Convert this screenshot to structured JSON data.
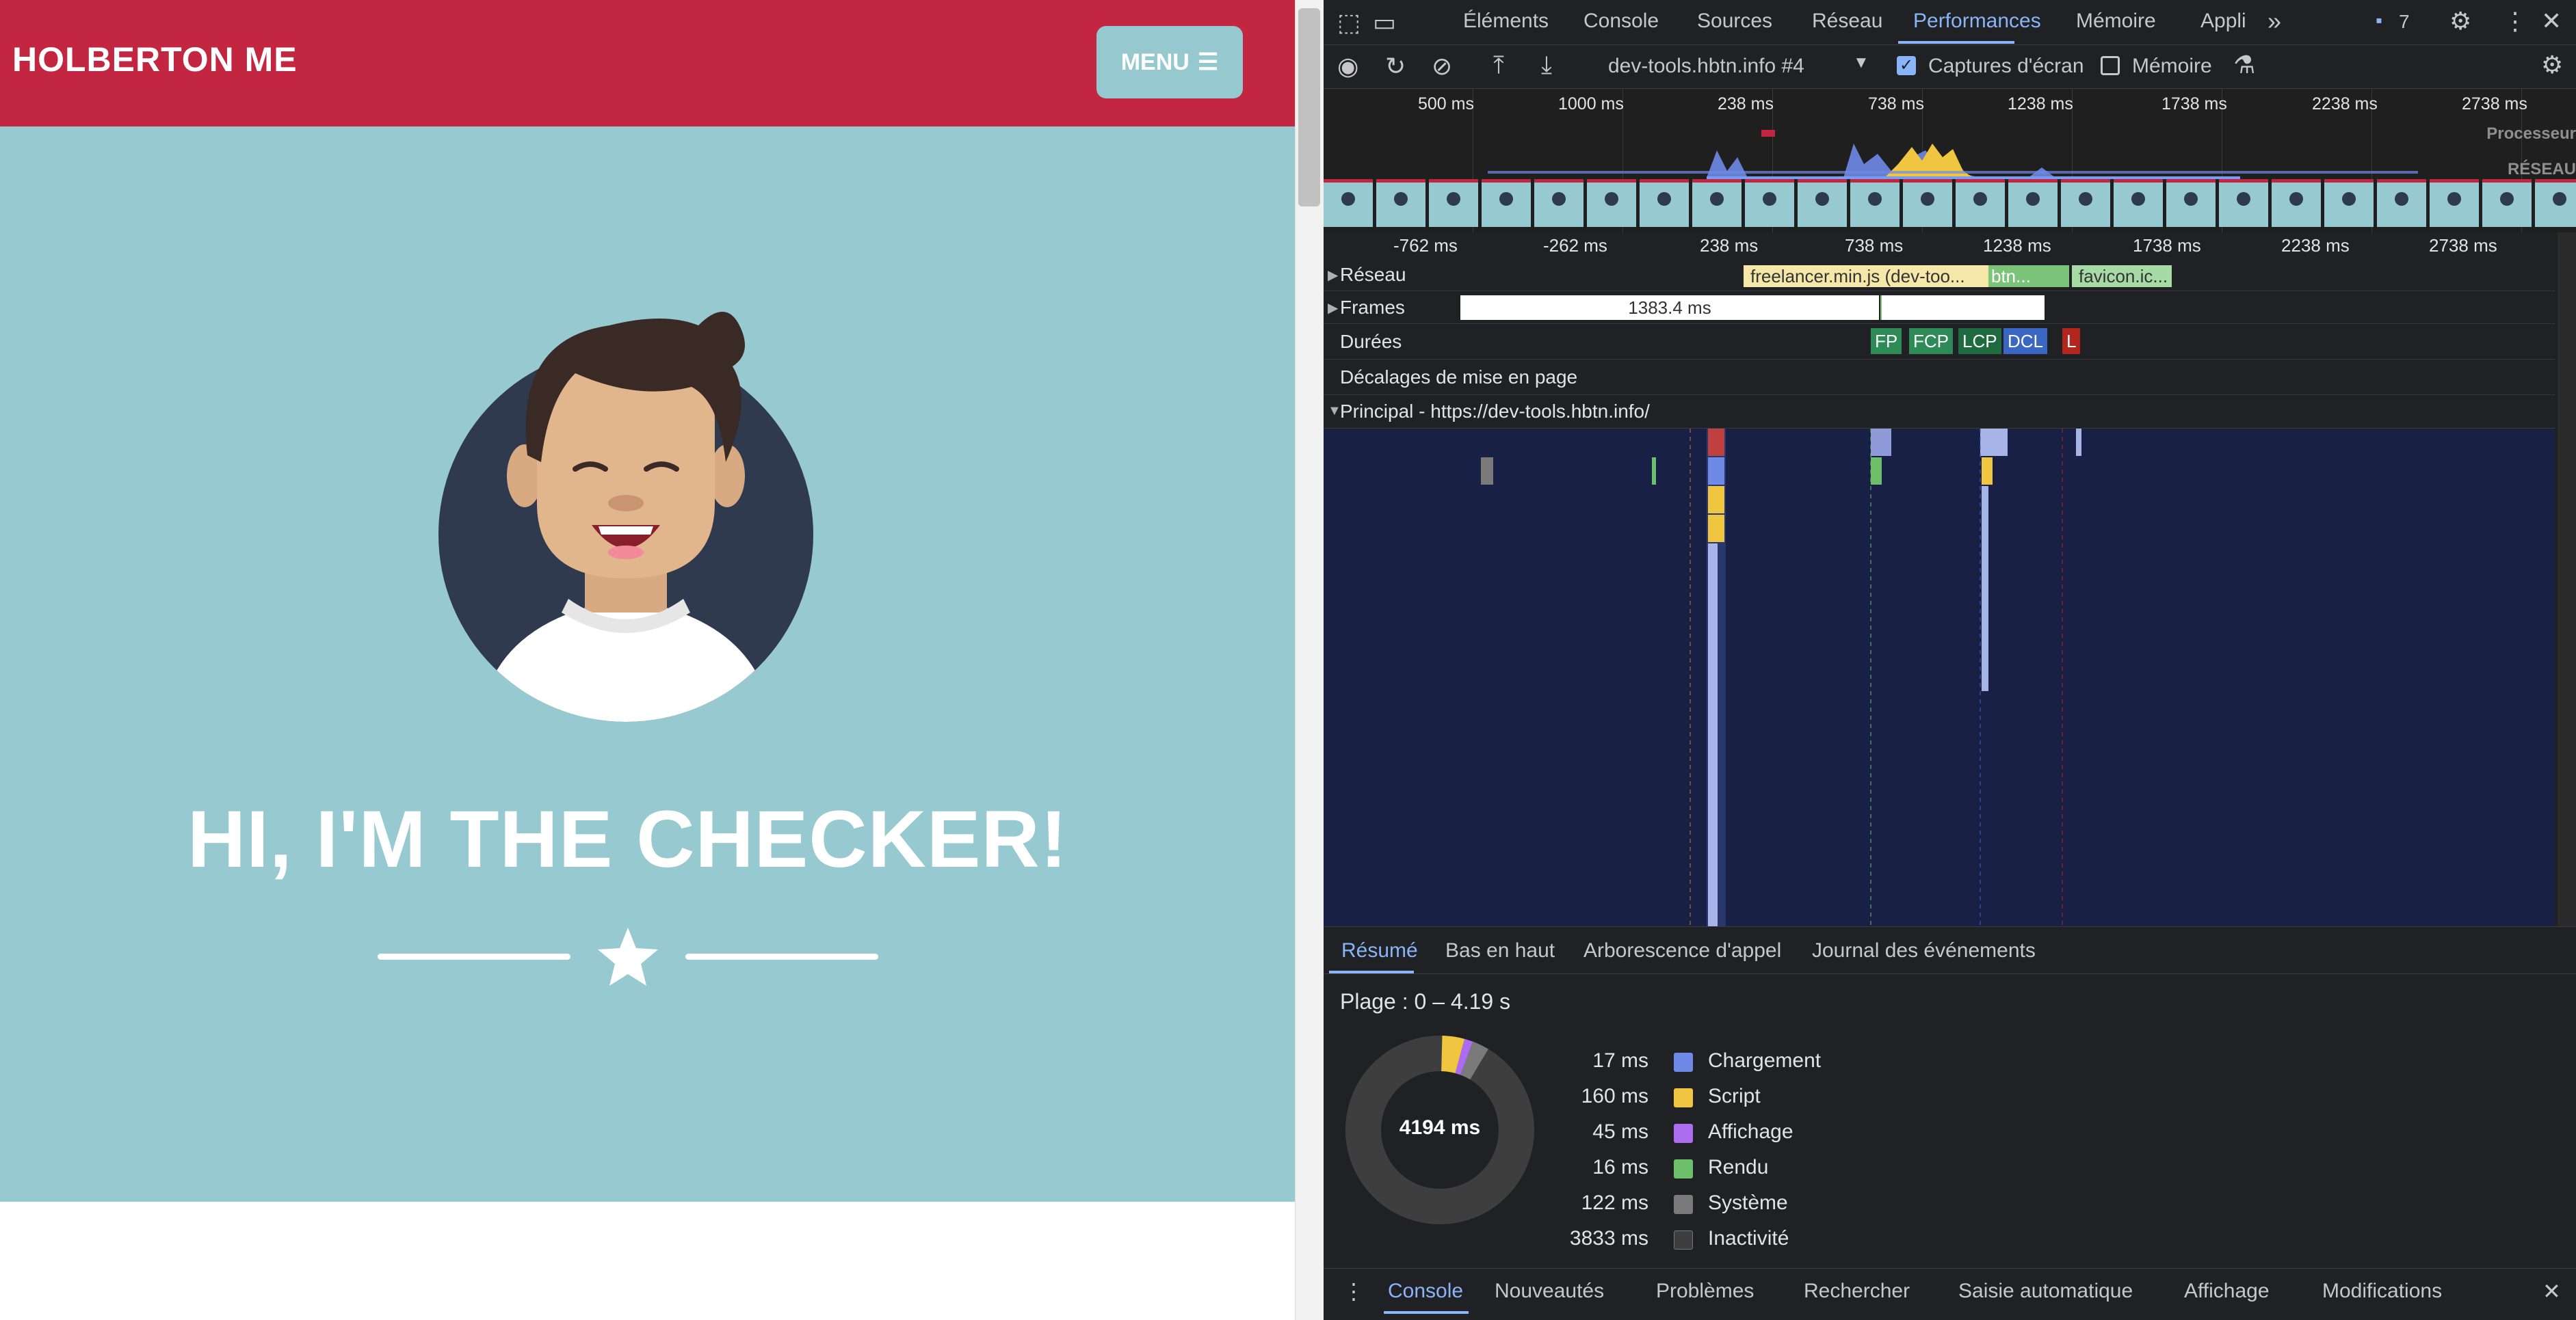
{
  "page": {
    "brand": "HOLBERTON ME",
    "menu_label": "MENU",
    "hero_title": "HI, I'M THE CHECKER!"
  },
  "devtools": {
    "tabs": [
      "Éléments",
      "Console",
      "Sources",
      "Réseau",
      "Performances",
      "Mémoire",
      "Appli"
    ],
    "active_tab": "Performances",
    "issues_count": "7",
    "toolbar": {
      "recording_select": "dev-tools.hbtn.info #4",
      "screenshots_label": "Captures d'écran",
      "screenshots_checked": true,
      "memory_label": "Mémoire",
      "memory_checked": false
    },
    "overview": {
      "ticks": [
        "500 ms",
        "1000 ms",
        "238 ms",
        "738 ms",
        "1238 ms",
        "1738 ms",
        "2238 ms",
        "2738 ms"
      ],
      "processor_label": "Processeur",
      "network_label": "RÉSEAU"
    },
    "flame": {
      "ticks": [
        "-762 ms",
        "-262 ms",
        "238 ms",
        "738 ms",
        "1238 ms",
        "1738 ms",
        "2238 ms",
        "2738 ms"
      ],
      "tracks": {
        "network": "Réseau",
        "frames": "Frames",
        "timings": "Durées",
        "layout_shifts": "Décalages de mise en page",
        "main": "Principal - https://dev-tools.hbtn.info/"
      },
      "network_items": [
        "freelancer.min.js (dev-too...",
        "btn...",
        "favicon.ic..."
      ],
      "frame_duration": "1383.4 ms",
      "markers": [
        "FP",
        "FCP",
        "LCP",
        "DCL",
        "L"
      ]
    },
    "bottom_tabs": [
      "Résumé",
      "Bas en haut",
      "Arborescence d'appel",
      "Journal des événements"
    ],
    "summary": {
      "range": "Plage : 0 – 4.19 s",
      "total": "4194 ms",
      "items": [
        {
          "value": "17 ms",
          "label": "Chargement",
          "color": "#6f8ae6"
        },
        {
          "value": "160 ms",
          "label": "Script",
          "color": "#f0c53f"
        },
        {
          "value": "45 ms",
          "label": "Affichage",
          "color": "#ab6cf0"
        },
        {
          "value": "16 ms",
          "label": "Rendu",
          "color": "#6cc06a"
        },
        {
          "value": "122 ms",
          "label": "Système",
          "color": "#7a7a7a"
        },
        {
          "value": "3833 ms",
          "label": "Inactivité",
          "color": "#3e3e3e"
        }
      ]
    },
    "drawer_tabs": [
      "Console",
      "Nouveautés",
      "Problèmes",
      "Rechercher",
      "Saisie automatique",
      "Affichage",
      "Modifications"
    ]
  }
}
